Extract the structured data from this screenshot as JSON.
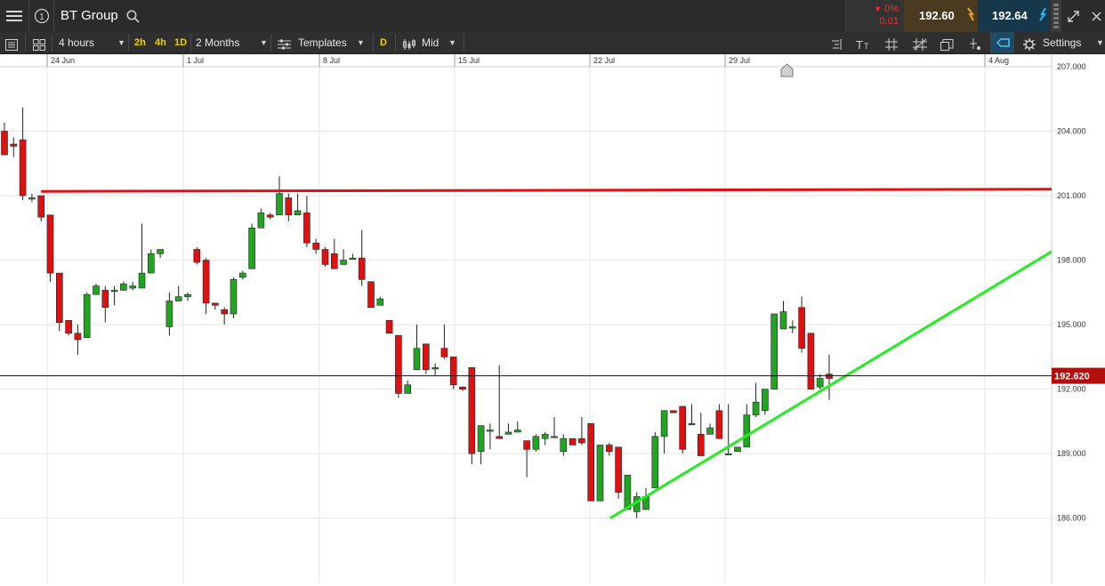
{
  "header": {
    "instrument": "BT Group",
    "change_pct": "0%",
    "change_abs": "0.01",
    "sell_price": "192.60",
    "buy_price": "192.64"
  },
  "toolbar": {
    "interval": "4 hours",
    "quick_2h": "2h",
    "quick_4h": "4h",
    "quick_1d": "1D",
    "range": "2 Months",
    "templates": "Templates",
    "d_label": "D",
    "price_type": "Mid",
    "settings": "Settings"
  },
  "colors": {
    "up": "#22a322",
    "down": "#dd1111",
    "resistance": "#e01010",
    "support": "#22ee22",
    "price_tag": "#b40d0d"
  },
  "chart_data": {
    "type": "candlestick",
    "x_labels": [
      "24 Jun",
      "1 Jul",
      "8 Jul",
      "15 Jul",
      "22 Jul",
      "29 Jul",
      "4 Aug"
    ],
    "y_ticks": [
      "207.000",
      "204.000",
      "201.000",
      "198.000",
      "195.000",
      "192.000",
      "189.000",
      "186.000"
    ],
    "ylim": [
      184.0,
      207.0
    ],
    "current_price": 192.62,
    "current_price_label": "192.620",
    "candles": [
      [
        204.4,
        203.4,
        204.0,
        202.9
      ],
      [
        203.7,
        202.8,
        203.4,
        203.3
      ],
      [
        205.1,
        200.8,
        203.6,
        201.0
      ],
      [
        201.1,
        200.7,
        200.9,
        200.9
      ],
      [
        201.0,
        199.8,
        201.0,
        200.0
      ],
      [
        200.1,
        197.0,
        200.1,
        197.4
      ],
      [
        197.4,
        194.7,
        197.4,
        195.1
      ],
      [
        195.2,
        194.5,
        195.2,
        194.6
      ],
      [
        195.0,
        193.6,
        194.6,
        194.3
      ],
      [
        196.5,
        194.4,
        194.4,
        196.4
      ],
      [
        196.9,
        196.4,
        196.4,
        196.8
      ],
      [
        196.8,
        195.1,
        196.6,
        195.8
      ],
      [
        196.8,
        195.9,
        196.6,
        196.6
      ],
      [
        197.0,
        196.6,
        196.6,
        196.9
      ],
      [
        197.0,
        196.6,
        196.7,
        196.8
      ],
      [
        199.7,
        196.7,
        196.7,
        197.4
      ],
      [
        198.5,
        197.4,
        197.4,
        198.3
      ],
      [
        198.5,
        198.1,
        198.3,
        198.5
      ],
      [
        196.5,
        194.5,
        194.9,
        196.1
      ],
      [
        196.8,
        196.1,
        196.1,
        196.3
      ],
      [
        196.5,
        196.1,
        196.3,
        196.4
      ],
      [
        198.6,
        197.8,
        198.5,
        197.9
      ],
      [
        198.1,
        195.5,
        198.0,
        196.0
      ],
      [
        196.0,
        195.7,
        196.0,
        195.9
      ],
      [
        195.8,
        195.0,
        195.7,
        195.5
      ],
      [
        197.2,
        195.3,
        195.5,
        197.1
      ],
      [
        197.5,
        197.1,
        197.2,
        197.4
      ],
      [
        199.7,
        197.6,
        197.6,
        199.5
      ],
      [
        200.4,
        199.5,
        199.5,
        200.2
      ],
      [
        200.2,
        199.9,
        200.1,
        200.0
      ],
      [
        201.9,
        200.1,
        200.1,
        201.1
      ],
      [
        201.1,
        199.8,
        200.9,
        200.1
      ],
      [
        201.1,
        200.1,
        200.1,
        200.3
      ],
      [
        201.0,
        198.6,
        200.2,
        198.8
      ],
      [
        199.0,
        198.3,
        198.8,
        198.5
      ],
      [
        198.6,
        197.7,
        198.5,
        197.8
      ],
      [
        199.0,
        197.9,
        198.3,
        197.6
      ],
      [
        198.5,
        197.8,
        197.8,
        198.0
      ],
      [
        198.3,
        198.1,
        198.1,
        198.1
      ],
      [
        199.4,
        196.8,
        198.1,
        197.1
      ],
      [
        197.0,
        195.8,
        197.0,
        195.8
      ],
      [
        196.3,
        195.9,
        195.9,
        196.2
      ],
      [
        195.2,
        194.6,
        195.2,
        194.6
      ],
      [
        194.5,
        191.6,
        194.5,
        191.8
      ],
      [
        192.4,
        191.8,
        191.8,
        192.2
      ],
      [
        195.0,
        192.9,
        192.9,
        193.9
      ],
      [
        194.1,
        192.7,
        194.1,
        192.9
      ],
      [
        193.2,
        192.6,
        193.0,
        193.0
      ],
      [
        195.0,
        193.4,
        193.9,
        193.5
      ],
      [
        193.5,
        192.0,
        193.5,
        192.2
      ],
      [
        192.1,
        191.9,
        192.1,
        192.0
      ],
      [
        193.0,
        188.5,
        193.0,
        189.0
      ],
      [
        190.3,
        188.5,
        189.1,
        190.3
      ],
      [
        190.4,
        189.2,
        190.1,
        190.1
      ],
      [
        193.1,
        189.7,
        189.8,
        189.7
      ],
      [
        190.4,
        189.9,
        189.9,
        190.0
      ],
      [
        190.5,
        190.0,
        190.0,
        190.1
      ],
      [
        189.6,
        187.9,
        189.6,
        189.2
      ],
      [
        189.9,
        189.1,
        189.2,
        189.8
      ],
      [
        190.0,
        189.4,
        189.7,
        189.9
      ],
      [
        190.7,
        189.8,
        189.8,
        189.8
      ],
      [
        189.9,
        188.9,
        189.1,
        189.7
      ],
      [
        189.7,
        189.4,
        189.7,
        189.4
      ],
      [
        190.7,
        189.4,
        189.7,
        189.5
      ],
      [
        190.4,
        187.3,
        190.4,
        186.8
      ],
      [
        189.1,
        186.8,
        186.8,
        189.4
      ],
      [
        189.5,
        188.9,
        189.4,
        189.1
      ],
      [
        189.3,
        186.9,
        189.3,
        187.2
      ],
      [
        188.0,
        186.4,
        186.4,
        188.0
      ],
      [
        187.2,
        186.0,
        186.3,
        187.0
      ],
      [
        187.4,
        186.4,
        186.4,
        187.0
      ],
      [
        190.0,
        187.4,
        187.4,
        189.8
      ],
      [
        191.0,
        189.0,
        189.8,
        191.0
      ],
      [
        191.0,
        190.9,
        191.0,
        190.9
      ],
      [
        191.2,
        189.0,
        191.2,
        189.2
      ],
      [
        191.3,
        190.4,
        190.4,
        190.4
      ],
      [
        190.9,
        189.0,
        189.9,
        188.9
      ],
      [
        190.4,
        189.9,
        189.9,
        190.2
      ],
      [
        191.3,
        189.9,
        191.0,
        189.7
      ],
      [
        191.3,
        189.0,
        189.0,
        189.0
      ],
      [
        189.3,
        189.1,
        189.1,
        189.3
      ],
      [
        191.3,
        189.3,
        189.3,
        190.8
      ],
      [
        192.3,
        190.7,
        190.8,
        191.4
      ],
      [
        192.0,
        190.8,
        191.0,
        192.0
      ],
      [
        195.5,
        192.0,
        192.0,
        195.5
      ],
      [
        196.1,
        194.8,
        194.8,
        195.6
      ],
      [
        195.2,
        194.6,
        194.9,
        194.9
      ],
      [
        196.3,
        193.7,
        195.8,
        193.9
      ],
      [
        194.6,
        192.0,
        194.6,
        192.0
      ],
      [
        192.7,
        192.0,
        192.1,
        192.5
      ],
      [
        193.6,
        191.5,
        192.7,
        192.5
      ]
    ],
    "resistance_line": {
      "from": [
        "1 Jul - 6 candles",
        201.2
      ],
      "to": [
        "right edge",
        201.3
      ]
    },
    "support_line": {
      "from": [
        186.0
      ],
      "to": [
        198.4
      ]
    }
  }
}
